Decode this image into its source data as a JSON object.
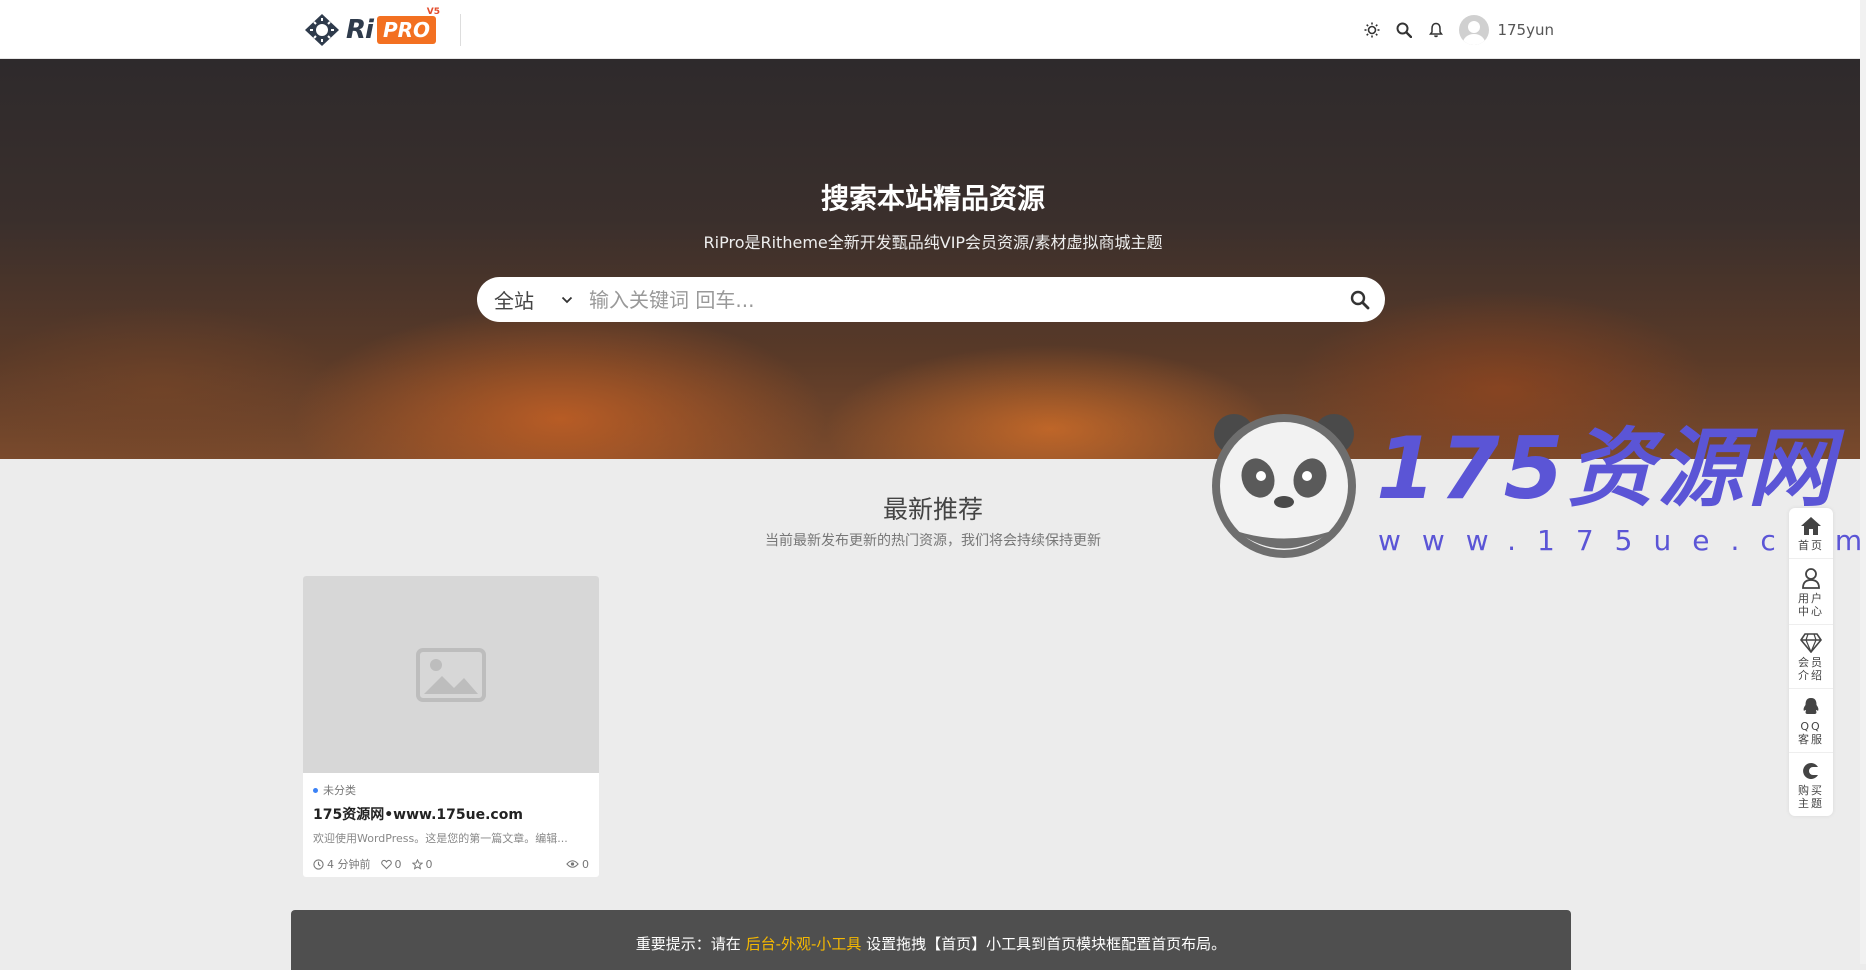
{
  "header": {
    "logo_ri": "Ri",
    "logo_pro": "PRO",
    "logo_version": "V5",
    "username": "175yun"
  },
  "hero": {
    "title": "搜索本站精品资源",
    "subtitle": "RiPro是Ritheme全新开发甄品纯VIP会员资源/素材虚拟商城主题",
    "search_scope": "全站",
    "search_placeholder": "输入关键词 回车..."
  },
  "section": {
    "title": "最新推荐",
    "subtitle": "当前最新发布更新的热门资源，我们将会持续保持更新"
  },
  "card": {
    "category": "未分类",
    "title": "175资源网•www.175ue.com",
    "excerpt": "欢迎使用WordPress。这是您的第一篇文章。编辑...",
    "time": "4 分钟前",
    "likes": "0",
    "favorites": "0",
    "views": "0"
  },
  "notice": {
    "prefix": "重要提示：请在 ",
    "link": "后台-外观-小工具",
    "suffix": " 设置拖拽【首页】小工具到首页模块框配置首页布局。"
  },
  "sidebar": {
    "items": [
      {
        "label": "首页",
        "icon": "home-icon"
      },
      {
        "label": "用户中心",
        "icon": "user-icon"
      },
      {
        "label": "会员介绍",
        "icon": "diamond-icon"
      },
      {
        "label": "QQ客服",
        "icon": "qq-icon"
      },
      {
        "label": "购买主题",
        "icon": "buy-icon"
      }
    ]
  },
  "watermark": {
    "text": "175资源网",
    "url": "www.175ue.com"
  },
  "colors": {
    "accent_orange": "#f37021",
    "notice_link": "#f5b800",
    "watermark": "#5b55d6"
  }
}
